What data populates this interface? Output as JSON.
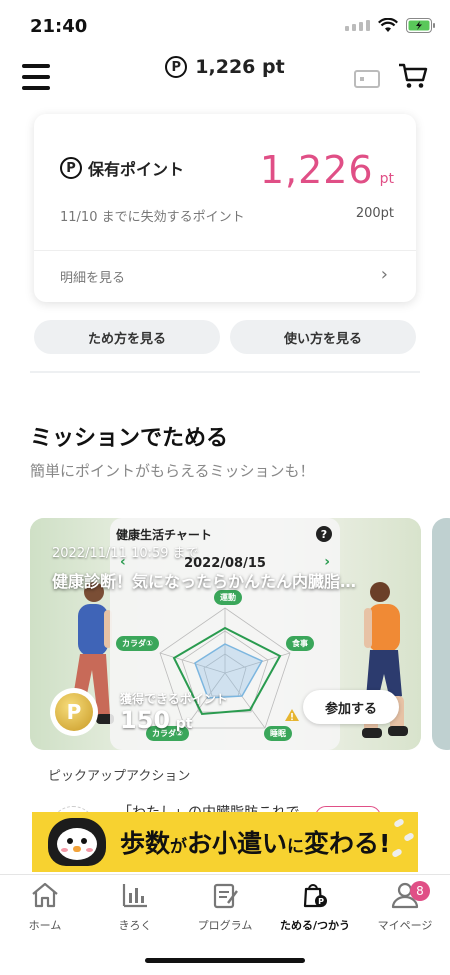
{
  "status_bar": {
    "time": "21:40"
  },
  "header": {
    "points": "1,226 pt",
    "point_symbol": "P"
  },
  "points_card": {
    "title": "保有ポイント",
    "value": "1,226",
    "unit": "pt",
    "expire_label": "11/10 までに失効するポイント",
    "expire_value": "200pt",
    "detail_link": "明細を見る"
  },
  "buttons": {
    "how_to_earn": "ため方を見る",
    "how_to_use": "使い方を見る"
  },
  "section": {
    "title": "ミッションでためる",
    "subtitle": "簡単にポイントがもらえるミッションも！"
  },
  "mission": {
    "chart_title": "健康生活チャート",
    "chart_date": "2022/08/15",
    "deadline": "2022/11/11 10:59 まで",
    "title": "健康診断！気になったらかんたん内臓脂…",
    "reward_label": "獲得できるポイント",
    "reward_value": "150",
    "reward_unit": "pt",
    "join_button": "参加する",
    "radar_labels": {
      "top": "運動",
      "right": "食事",
      "left": "カラダ①",
      "bottom_right": "睡眠",
      "bottom_left": "カラダ②"
    },
    "help": "?"
  },
  "pickup": {
    "label": "ピックアップアクション",
    "item_title": "「わたし」の内臓脂肪これで…"
  },
  "banner": {
    "part1": "歩数",
    "part2": "が",
    "part3": "お小遣い",
    "part4": "に",
    "part5": "変わる!"
  },
  "tabs": [
    {
      "label": "ホーム",
      "icon": "home-icon"
    },
    {
      "label": "きろく",
      "icon": "bar-chart-icon"
    },
    {
      "label": "プログラム",
      "icon": "clipboard-icon"
    },
    {
      "label": "ためる/つかう",
      "icon": "bag-points-icon"
    },
    {
      "label": "マイページ",
      "icon": "person-icon",
      "badge": "8"
    }
  ],
  "colors": {
    "accent_pink": "#e04f86",
    "chart_green": "#3aa65a"
  }
}
